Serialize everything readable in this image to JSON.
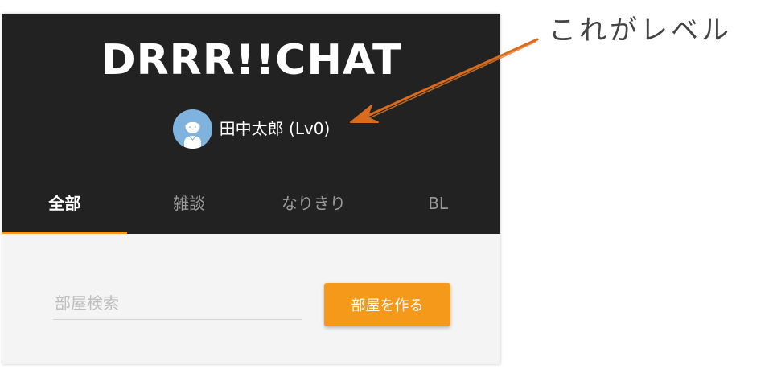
{
  "app": {
    "logo": "DRRR!!CHAT",
    "user": {
      "name_label": "田中太郎 (Lv0)"
    },
    "tabs": [
      {
        "label": "全部",
        "active": true
      },
      {
        "label": "雑談",
        "active": false
      },
      {
        "label": "なりきり",
        "active": false
      },
      {
        "label": "BL",
        "active": false
      }
    ],
    "search": {
      "placeholder": "部屋検索",
      "value": ""
    },
    "create_button": {
      "label": "部屋を作る"
    }
  },
  "annotation": {
    "text": "これがレベル"
  },
  "colors": {
    "header_bg": "#222222",
    "accent": "#f5991b",
    "body_bg": "#f4f4f4",
    "avatar_bg": "#7fb3dd",
    "annotation_arrow": "#d96b1a"
  },
  "icons": {
    "avatar": "default-user-avatar-icon",
    "arrow": "annotation-arrow-icon"
  }
}
